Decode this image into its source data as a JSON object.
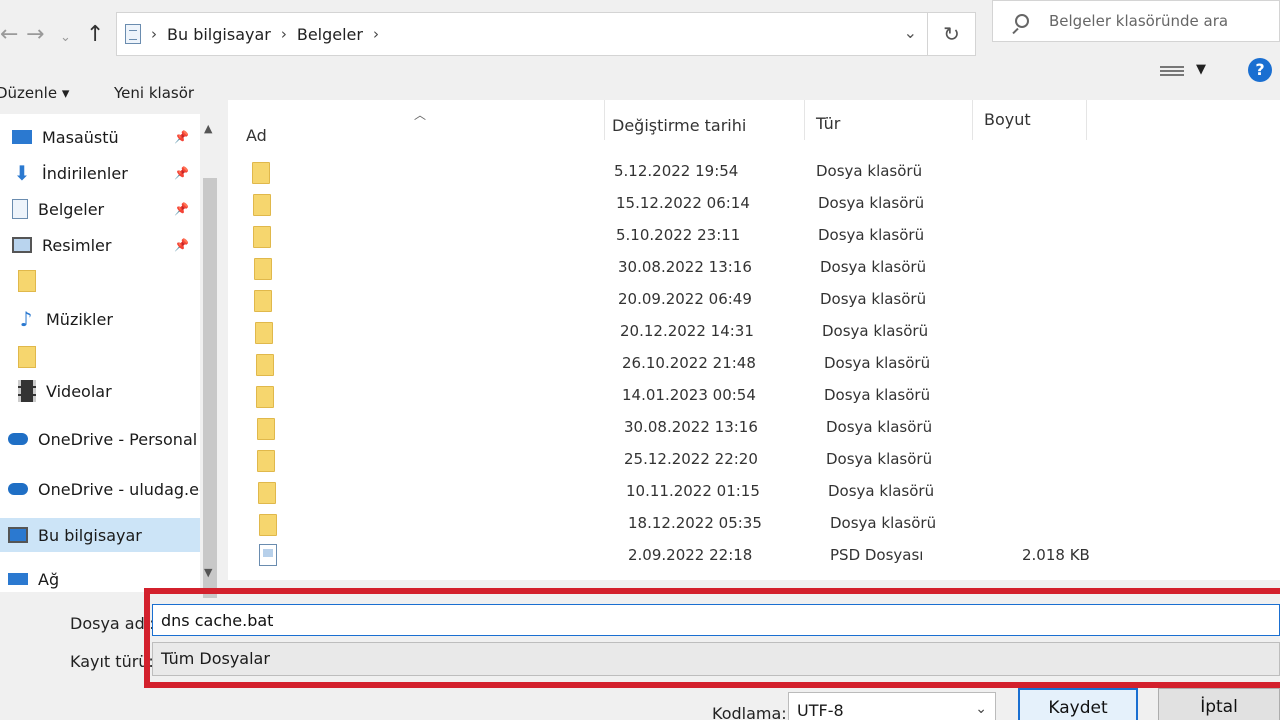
{
  "address": {
    "crumbs": [
      "Bu bilgisayar",
      "Belgeler"
    ],
    "search_placeholder": "Belgeler klasöründe ara"
  },
  "toolbar": {
    "organize_label": "Düzenle",
    "new_folder_label": "Yeni klasör"
  },
  "nav": {
    "items": [
      {
        "label": "Masaüstü",
        "pinned": true
      },
      {
        "label": "İndirilenler",
        "pinned": true
      },
      {
        "label": "Belgeler",
        "pinned": true
      },
      {
        "label": "Resimler",
        "pinned": true
      },
      {
        "label": "",
        "pinned": false
      },
      {
        "label": "Müzikler",
        "pinned": false
      },
      {
        "label": "",
        "pinned": false
      },
      {
        "label": "Videolar",
        "pinned": false
      },
      {
        "label": "OneDrive - Personal",
        "pinned": false
      },
      {
        "label": "OneDrive - uludag.edu",
        "pinned": false
      },
      {
        "label": "Bu bilgisayar",
        "pinned": false,
        "selected": true
      },
      {
        "label": "Ağ",
        "pinned": false
      }
    ]
  },
  "columns": {
    "name": "Ad",
    "date": "Değiştirme tarihi",
    "type": "Tür",
    "size": "Boyut"
  },
  "files": [
    {
      "date": "5.12.2022 19:54",
      "type": "Dosya klasörü",
      "size": "",
      "kind": "folder"
    },
    {
      "date": "15.12.2022 06:14",
      "type": "Dosya klasörü",
      "size": "",
      "kind": "folder"
    },
    {
      "date": "5.10.2022 23:11",
      "type": "Dosya klasörü",
      "size": "",
      "kind": "folder"
    },
    {
      "date": "30.08.2022 13:16",
      "type": "Dosya klasörü",
      "size": "",
      "kind": "folder"
    },
    {
      "date": "20.09.2022 06:49",
      "type": "Dosya klasörü",
      "size": "",
      "kind": "folder"
    },
    {
      "date": "20.12.2022 14:31",
      "type": "Dosya klasörü",
      "size": "",
      "kind": "folder"
    },
    {
      "date": "26.10.2022 21:48",
      "type": "Dosya klasörü",
      "size": "",
      "kind": "folder"
    },
    {
      "date": "14.01.2023 00:54",
      "type": "Dosya klasörü",
      "size": "",
      "kind": "folder"
    },
    {
      "date": "30.08.2022 13:16",
      "type": "Dosya klasörü",
      "size": "",
      "kind": "folder"
    },
    {
      "date": "25.12.2022 22:20",
      "type": "Dosya klasörü",
      "size": "",
      "kind": "folder"
    },
    {
      "date": "10.11.2022 01:15",
      "type": "Dosya klasörü",
      "size": "",
      "kind": "folder"
    },
    {
      "date": "18.12.2022 05:35",
      "type": "Dosya klasörü",
      "size": "",
      "kind": "folder"
    },
    {
      "date": "2.09.2022 22:18",
      "type": "PSD Dosyası",
      "size": "2.018 KB",
      "kind": "psd"
    }
  ],
  "save": {
    "filename_label": "Dosya adı:",
    "filename_value": "dns cache.bat",
    "type_label": "Kayıt türü:",
    "type_value": "Tüm Dosyalar",
    "encoding_label": "Kodlama:",
    "encoding_value": "UTF-8",
    "save_button": "Kaydet",
    "cancel_button": "İptal"
  },
  "colors": {
    "highlight": "#d3202c",
    "accent": "#1a6fd1",
    "folder": "#f6d66e"
  }
}
